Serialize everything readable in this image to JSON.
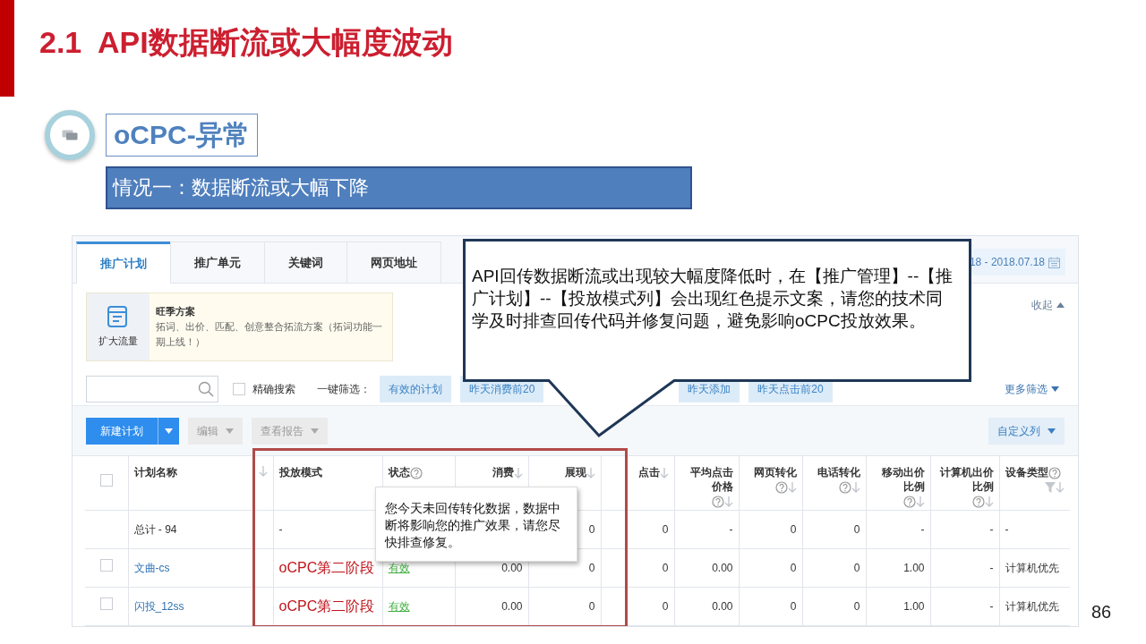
{
  "slide": {
    "title": "2.1  API数据断流或大幅度波动",
    "section": "oCPC-异常",
    "banner": "情况一：数据断流或大幅下降",
    "page_number": "86"
  },
  "screenshot": {
    "tabs": [
      {
        "label": "推广计划",
        "selected": true
      },
      {
        "label": "推广单元",
        "selected": false
      },
      {
        "label": "关键词",
        "selected": false
      },
      {
        "label": "网页地址",
        "selected": false
      }
    ],
    "date_range": "18 - 2018.07.18",
    "promo": {
      "button": "扩大流量",
      "title": "旺季方案",
      "text": "拓词、出价、匹配、创意整合拓流方案（拓词功能一期上线！）"
    },
    "collapse": "收起",
    "search": {
      "exact_label": "精确搜索",
      "exact_checked": false
    },
    "quick_filter_label": "一键筛选：",
    "quick_filters": [
      "有效的计划",
      "昨天消费前20",
      "昨天添加",
      "昨天点击前20"
    ],
    "more_filters": "更多筛选",
    "buttons": [
      {
        "label": "新建计划",
        "kind": "split",
        "disabled": false
      },
      {
        "label": "编辑",
        "kind": "dropdown",
        "disabled": true
      },
      {
        "label": "查看报告",
        "kind": "dropdown",
        "disabled": true
      }
    ],
    "custom_columns": "自定义列",
    "table": {
      "header_checked": false,
      "columns": [
        {
          "label": "计划名称",
          "kind": "name",
          "help": false,
          "sort": true
        },
        {
          "label": "投放模式",
          "kind": "mode",
          "help": false,
          "sort": false
        },
        {
          "label": "状态",
          "kind": "status",
          "help": true,
          "sort": false
        },
        {
          "label": "消费",
          "kind": "num",
          "help": false,
          "sort": true
        },
        {
          "label": "展现",
          "kind": "num",
          "help": false,
          "sort": true
        },
        {
          "label": "点击",
          "kind": "num",
          "help": false,
          "sort": true
        },
        {
          "label": "平均点击价格",
          "kind": "num",
          "help": true,
          "sort": true
        },
        {
          "label": "网页转化",
          "kind": "num",
          "help": true,
          "sort": true
        },
        {
          "label": "电话转化",
          "kind": "num",
          "help": true,
          "sort": true
        },
        {
          "label": "移动出价比例",
          "kind": "num",
          "help": true,
          "sort": true
        },
        {
          "label": "计算机出价比例",
          "kind": "num",
          "help": true,
          "sort": true
        },
        {
          "label": "设备类型",
          "kind": "text",
          "help": true,
          "sort": true,
          "filter": true
        }
      ],
      "rows": [
        {
          "kind": "total",
          "cells": [
            "总计 - 94",
            "-",
            null,
            null,
            "0",
            "0",
            "-",
            "0",
            "0",
            "-",
            "-",
            "-"
          ]
        },
        {
          "kind": "plan",
          "checked": false,
          "cells": [
            "文曲-cs",
            "oCPC第二阶段",
            "有效",
            "0.00",
            "0",
            "0",
            "0.00",
            "0",
            "0",
            "1.00",
            "-",
            "计算机优先"
          ]
        },
        {
          "kind": "plan",
          "checked": false,
          "cells": [
            "闪投_12ss",
            "oCPC第二阶段",
            "有效",
            "0.00",
            "0",
            "0",
            "0.00",
            "0",
            "0",
            "1.00",
            "-",
            "计算机优先"
          ]
        }
      ]
    }
  },
  "callouts": [
    {
      "text": "API回传数据断流或出现较大幅度降低时，在【推广管理】--【推广计划】--【投放模式列】会出现红色提示文案，请您的技术同学及时排查回传代码并修复问题，避免影响oCPC投放效果。"
    },
    {
      "text": "您今天未回传转化数据，数据中断将影响您的推广效果，请您尽快排查修复。"
    }
  ]
}
